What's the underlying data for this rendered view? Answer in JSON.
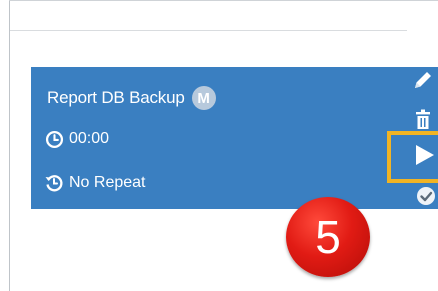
{
  "card": {
    "title": "Report DB Backup",
    "badge": "M",
    "time": "00:00",
    "repeat": "No Repeat"
  },
  "icons": {
    "time": "clock-icon",
    "repeat": "history-icon",
    "edit": "pencil-icon",
    "delete": "trash-icon",
    "run": "play-icon",
    "complete": "check-icon"
  },
  "annotation": {
    "step_number": "5"
  },
  "colors": {
    "card_background": "#3a7fc1",
    "highlight_border": "#f1b424",
    "badge_background": "#b7c9dc",
    "step_badge": "#e11b14"
  }
}
